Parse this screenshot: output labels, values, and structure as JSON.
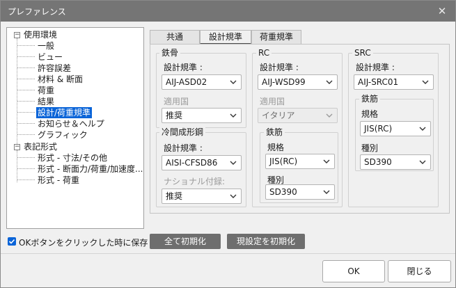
{
  "window": {
    "title": "プレファレンス",
    "close_glyph": "✕"
  },
  "tree": {
    "groups": [
      {
        "label": "使用環境",
        "expand_glyph": "−",
        "items": [
          "一般",
          "ビュー",
          "許容誤差",
          "材料 & 断面",
          "荷重",
          "結果",
          "設計/荷重規準",
          "お知らせ＆ヘルプ",
          "グラフィック"
        ]
      },
      {
        "label": "表記形式",
        "expand_glyph": "−",
        "items": [
          "形式 - 寸法/その他",
          "形式 - 断面力/荷重/加速度...",
          "形式 - 荷重"
        ]
      }
    ],
    "selected": "設計/荷重規準"
  },
  "tabs": [
    "共通",
    "設計規準",
    "荷重規準"
  ],
  "active_tab": "設計規準",
  "steel": {
    "title": "鉄骨",
    "code_label": "設計規準 :",
    "code_value": "AIJ-ASD02",
    "country_label": "適用国",
    "country_value": "推奨"
  },
  "cold_formed": {
    "title": "冷間成形鋼",
    "code_label": "設計規準 :",
    "code_value": "AISI-CFSD86",
    "annex_label": "ナショナル付録:",
    "annex_value": "推奨"
  },
  "rc": {
    "title": "RC",
    "code_label": "設計規準 :",
    "code_value": "AIJ-WSD99",
    "country_label": "適用国",
    "country_value": "イタリア",
    "rebar": {
      "title": "鉄筋",
      "std_label": "規格",
      "std_value": "JIS(RC)",
      "grade_label": "種別",
      "grade_value": "SD390"
    }
  },
  "src": {
    "title": "SRC",
    "code_label": "設計規準 :",
    "code_value": "AIJ-SRC01",
    "rebar": {
      "title": "鉄筋",
      "std_label": "規格",
      "std_value": "JIS(RC)",
      "grade_label": "種別",
      "grade_value": "SD390"
    }
  },
  "options": {
    "save_on_ok_label": "OKボタンをクリックした時に保存",
    "save_on_ok_checked": true
  },
  "buttons": {
    "reset_all": "全て初期化",
    "reset_current": "現設定を初期化",
    "ok": "OK",
    "close": "閉じる"
  },
  "colors": {
    "accent": "#0a64d8",
    "titlebar": "#757575",
    "dark_button": "#6e6e6e"
  }
}
